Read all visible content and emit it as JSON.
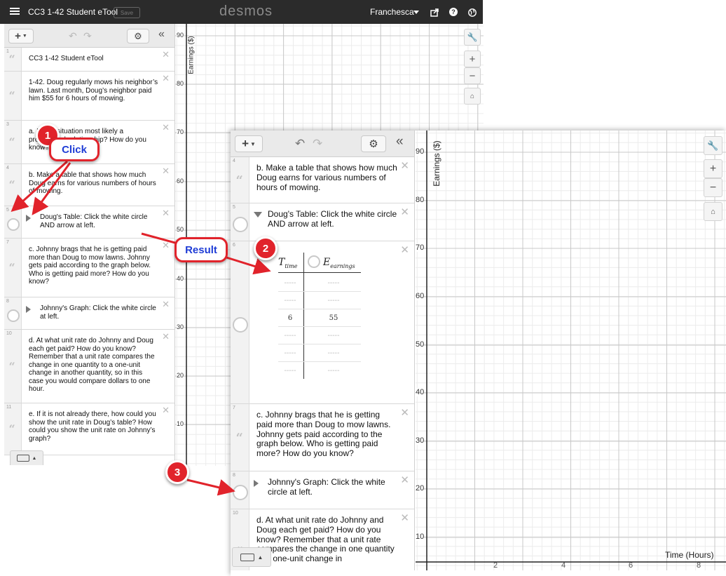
{
  "app": {
    "title": "CC3 1-42 Student eTool",
    "save_label": "Save",
    "logo": "desmos",
    "user": "Franchesca",
    "icons": [
      "menu-icon",
      "share-icon",
      "help-icon",
      "globe-icon"
    ]
  },
  "back_window": {
    "expressions": [
      {
        "num": "1",
        "text": "CC3 1-42 Student eTool"
      },
      {
        "num": "",
        "text": "1-42. Doug regularly mows his neighbor’s lawn. Last month, Doug’s neighbor paid him $55 for 6 hours of mowing."
      },
      {
        "num": "3",
        "text": "a. Is this situation most likely a proportional relationship? How do you know?"
      },
      {
        "num": "4",
        "text": "b. Make a table that shows how much Doug earns for various numbers of hours of mowing."
      },
      {
        "num": "5",
        "text": "Doug's Table: Click the white circle AND arrow at left."
      },
      {
        "num": "7",
        "text": "c. Johnny brags that he is getting paid more than Doug to mow lawns. Johnny gets paid according to the graph below. Who is getting paid more? How do you know?"
      },
      {
        "num": "8",
        "text": "Johnny's Graph: Click the white circle at left."
      },
      {
        "num": "10",
        "text": "d. At what unit rate do Johnny and Doug each get paid? How do you know? Remember that a unit rate compares the change in one quantity to a one-unit change in another quantity, so in this case you would compare dollars to one hour."
      },
      {
        "num": "11",
        "text": "e. If it is not already there, how could you show the unit rate in Doug’s table? How could you show the unit rate on Johnny’s graph?"
      }
    ],
    "graph": {
      "y_label": "Earnings ($)",
      "y_ticks": [
        "90",
        "80",
        "70",
        "60",
        "50",
        "40",
        "30",
        "20",
        "10"
      ]
    }
  },
  "front_window": {
    "expressions": [
      {
        "num": "4",
        "text": "b. Make a table that shows how much Doug earns for various numbers of hours of mowing."
      },
      {
        "num": "5",
        "text": "Doug's Table: Click the white circle AND arrow at left."
      },
      {
        "num": "6",
        "table": true
      },
      {
        "num": "7",
        "text": "c. Johnny brags that he is getting paid more than Doug to mow lawns. Johnny gets paid according to the graph below. Who is getting paid more? How do you know?"
      },
      {
        "num": "8",
        "text": "Johnny's Graph: Click the white circle at left."
      },
      {
        "num": "10",
        "text": "d. At what unit rate do Johnny and Doug each get paid? How do you know? Remember that a unit rate compares the change in one quantity to a one-unit change in"
      }
    ],
    "table": {
      "col1_main": "T",
      "col1_sub": "time",
      "col2_main": "E",
      "col2_sub": "earnings",
      "rows": [
        [
          "-----",
          "-----"
        ],
        [
          "-----",
          "-----"
        ],
        [
          "6",
          "55"
        ],
        [
          "-----",
          "-----"
        ],
        [
          "-----",
          "-----"
        ],
        [
          "-----",
          "-----"
        ]
      ]
    },
    "graph": {
      "y_label": "Earnings ($)",
      "x_label": "Time (Hours)",
      "y_ticks": [
        "90",
        "80",
        "70",
        "60",
        "50",
        "40",
        "30",
        "20",
        "10"
      ],
      "x_ticks": [
        "2",
        "4",
        "6",
        "8"
      ]
    }
  },
  "annotations": {
    "badge1": "1",
    "click_label": "Click",
    "badge2": "2",
    "result_label": "Result",
    "badge3": "3",
    "color": "#e1232b",
    "label_color": "#1f3dd6"
  }
}
